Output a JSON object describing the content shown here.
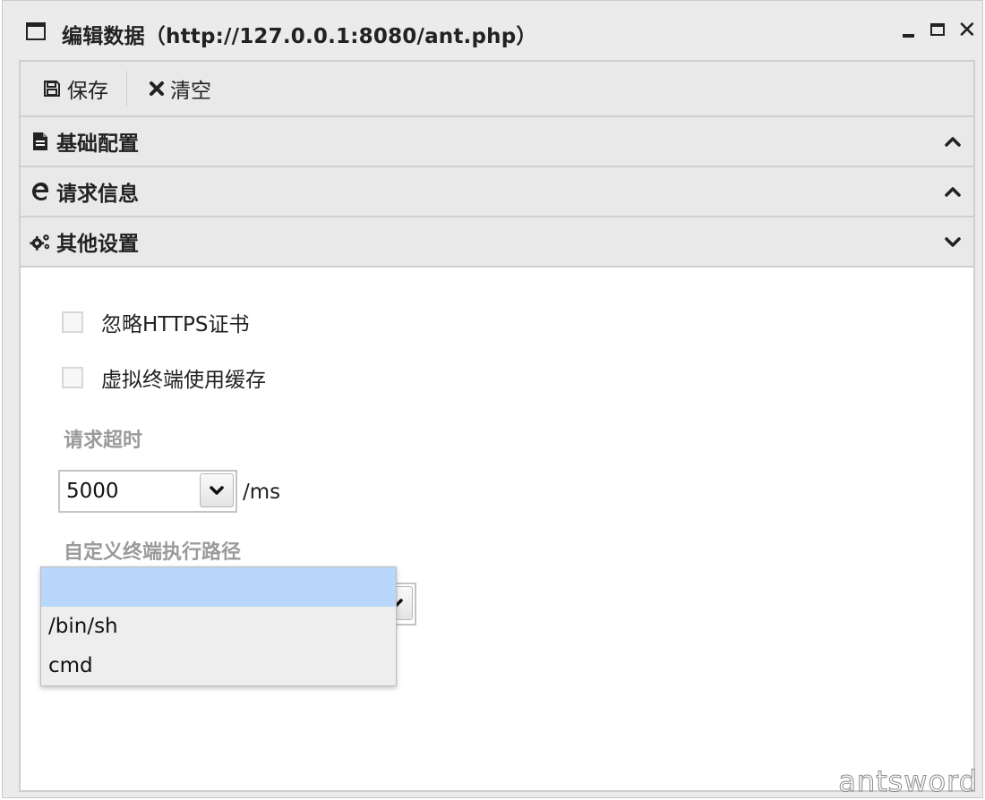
{
  "window": {
    "title": "编辑数据（http://127.0.0.1:8080/ant.php）",
    "icon": "window-icon"
  },
  "toolbar": {
    "save_label": "保存",
    "clear_label": "清空"
  },
  "accordion": {
    "basic": "基础配置",
    "request": "请求信息",
    "other": "其他设置"
  },
  "other_settings": {
    "ignore_https_label": "忽略HTTPS证书",
    "terminal_cache_label": "虚拟终端使用缓存",
    "ignore_https_checked": false,
    "terminal_cache_checked": false,
    "timeout_label": "请求超时",
    "timeout_value": "5000",
    "timeout_unit": "/ms",
    "terminal_path_label": "自定义终端执行路径",
    "terminal_path_value": "",
    "terminal_path_options": [
      "",
      "/bin/sh",
      "cmd"
    ]
  },
  "watermark": "antsword",
  "colors": {
    "highlight": "#b8d7fb",
    "header_bg": "#e9e9e9",
    "label_gray": "#9a9a9a"
  }
}
